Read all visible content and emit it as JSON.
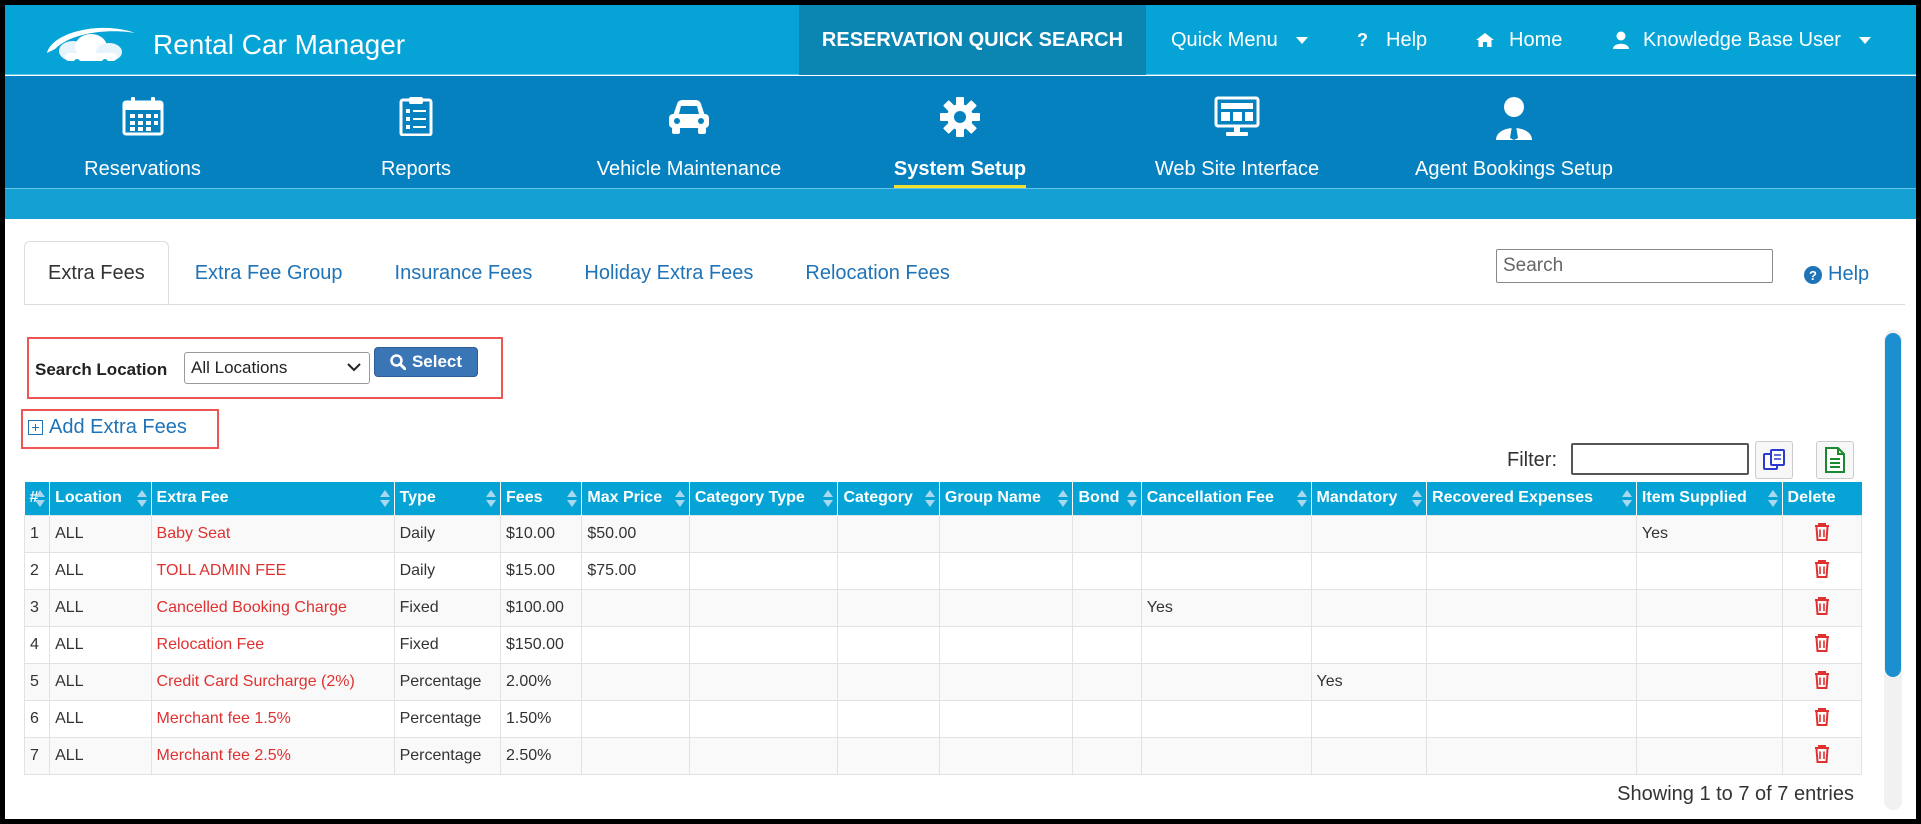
{
  "app": {
    "title": "Rental Car Manager"
  },
  "topbar": {
    "quick_search": "RESERVATION QUICK SEARCH",
    "quick_menu": "Quick Menu",
    "help": "Help",
    "home": "Home",
    "user": "Knowledge Base User"
  },
  "modules": [
    {
      "label": "Reservations",
      "icon": "calendar-icon"
    },
    {
      "label": "Reports",
      "icon": "clipboard-icon"
    },
    {
      "label": "Vehicle Maintenance",
      "icon": "car-icon"
    },
    {
      "label": "System Setup",
      "icon": "gear-icon",
      "active": true
    },
    {
      "label": "Web Site Interface",
      "icon": "monitor-icon"
    },
    {
      "label": "Agent Bookings Setup",
      "icon": "agent-icon"
    }
  ],
  "tabs": [
    {
      "label": "Extra Fees",
      "active": true
    },
    {
      "label": "Extra Fee Group"
    },
    {
      "label": "Insurance Fees"
    },
    {
      "label": "Holiday Extra Fees"
    },
    {
      "label": "Relocation Fees"
    }
  ],
  "page_search": {
    "placeholder": "Search"
  },
  "page_help": "Help",
  "search_location": {
    "label": "Search Location",
    "selected": "All Locations",
    "button": "Select"
  },
  "add_extra_fees": "Add Extra Fees",
  "filter": {
    "label": "Filter:",
    "value": ""
  },
  "table": {
    "columns": [
      "#",
      "Location",
      "Extra Fee",
      "Type",
      "Fees",
      "Max Price",
      "Category Type",
      "Category",
      "Group Name",
      "Bond",
      "Cancellation Fee",
      "Mandatory",
      "Recovered Expenses",
      "Item Supplied",
      "Delete"
    ],
    "rows": [
      [
        "1",
        "ALL",
        "Baby Seat",
        "Daily",
        "$10.00",
        "$50.00",
        "",
        "",
        "",
        "",
        "",
        "",
        "",
        "Yes"
      ],
      [
        "2",
        "ALL",
        "TOLL ADMIN FEE",
        "Daily",
        "$15.00",
        "$75.00",
        "",
        "",
        "",
        "",
        "",
        "",
        "",
        ""
      ],
      [
        "3",
        "ALL",
        "Cancelled Booking Charge",
        "Fixed",
        "$100.00",
        "",
        "",
        "",
        "",
        "",
        "Yes",
        "",
        "",
        ""
      ],
      [
        "4",
        "ALL",
        "Relocation Fee",
        "Fixed",
        "$150.00",
        "",
        "",
        "",
        "",
        "",
        "",
        "",
        "",
        ""
      ],
      [
        "5",
        "ALL",
        "Credit Card Surcharge (2%)",
        "Percentage",
        "2.00%",
        "",
        "",
        "",
        "",
        "",
        "",
        "Yes",
        "",
        ""
      ],
      [
        "6",
        "ALL",
        "Merchant fee 1.5%",
        "Percentage",
        "1.50%",
        "",
        "",
        "",
        "",
        "",
        "",
        "",
        "",
        ""
      ],
      [
        "7",
        "ALL",
        "Merchant fee 2.5%",
        "Percentage",
        "2.50%",
        "",
        "",
        "",
        "",
        "",
        "",
        "",
        "",
        ""
      ]
    ]
  },
  "entries_info": "Showing 1 to 7 of 7 entries",
  "colors": {
    "topbar": "#06a4d6",
    "module_bar": "#0581c0",
    "link": "#1f73b7",
    "fee_name": "#e03131",
    "highlight_box": "#ee5555"
  }
}
